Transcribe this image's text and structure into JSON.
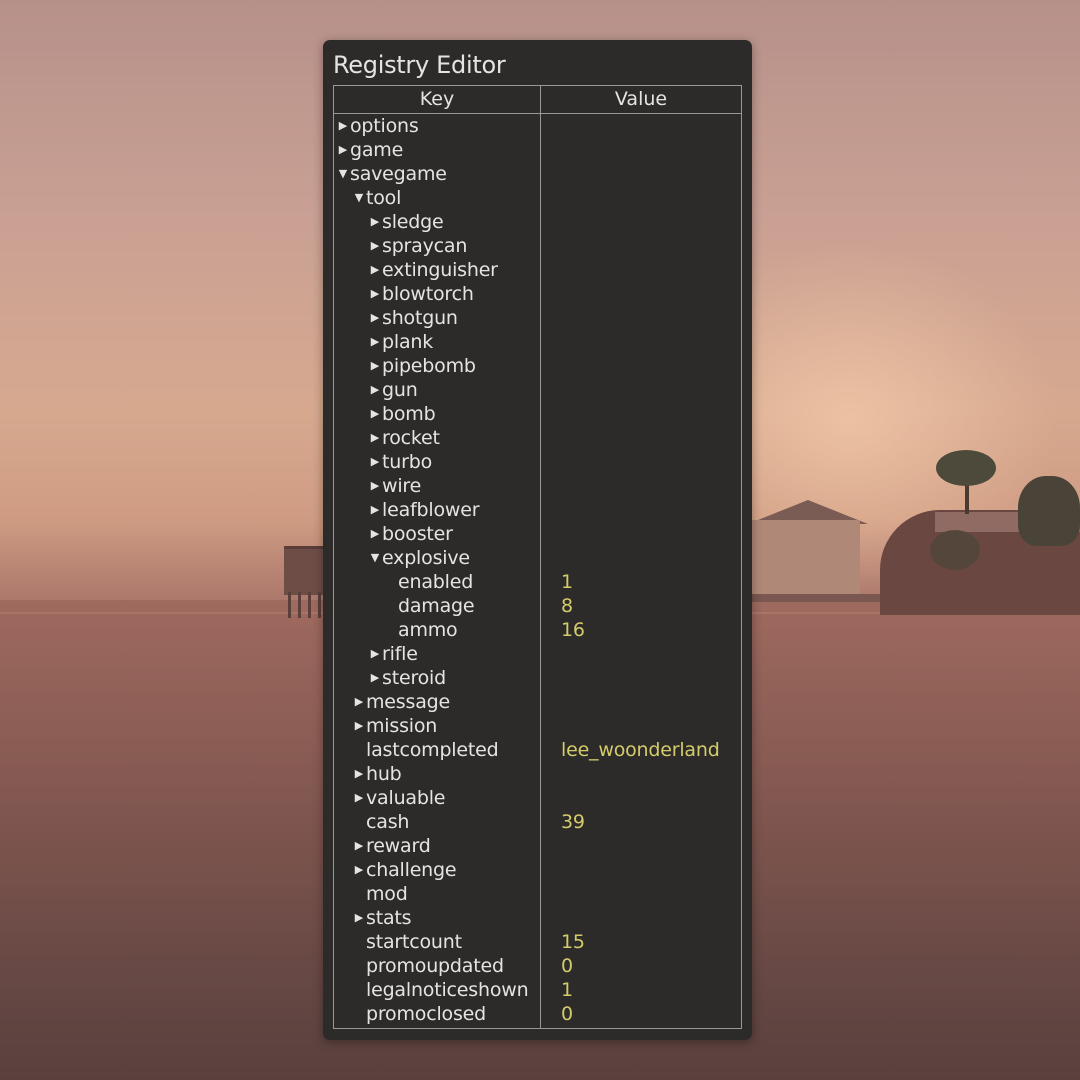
{
  "window": {
    "title": "Registry Editor"
  },
  "table": {
    "columns": [
      "Key",
      "Value"
    ],
    "rows": [
      {
        "key": "options",
        "value": "",
        "depth": 0,
        "expander": "collapsed"
      },
      {
        "key": "game",
        "value": "",
        "depth": 0,
        "expander": "collapsed"
      },
      {
        "key": "savegame",
        "value": "",
        "depth": 0,
        "expander": "expanded"
      },
      {
        "key": "tool",
        "value": "",
        "depth": 1,
        "expander": "expanded"
      },
      {
        "key": "sledge",
        "value": "",
        "depth": 2,
        "expander": "collapsed"
      },
      {
        "key": "spraycan",
        "value": "",
        "depth": 2,
        "expander": "collapsed"
      },
      {
        "key": "extinguisher",
        "value": "",
        "depth": 2,
        "expander": "collapsed"
      },
      {
        "key": "blowtorch",
        "value": "",
        "depth": 2,
        "expander": "collapsed"
      },
      {
        "key": "shotgun",
        "value": "",
        "depth": 2,
        "expander": "collapsed"
      },
      {
        "key": "plank",
        "value": "",
        "depth": 2,
        "expander": "collapsed"
      },
      {
        "key": "pipebomb",
        "value": "",
        "depth": 2,
        "expander": "collapsed"
      },
      {
        "key": "gun",
        "value": "",
        "depth": 2,
        "expander": "collapsed"
      },
      {
        "key": "bomb",
        "value": "",
        "depth": 2,
        "expander": "collapsed"
      },
      {
        "key": "rocket",
        "value": "",
        "depth": 2,
        "expander": "collapsed"
      },
      {
        "key": "turbo",
        "value": "",
        "depth": 2,
        "expander": "collapsed"
      },
      {
        "key": "wire",
        "value": "",
        "depth": 2,
        "expander": "collapsed"
      },
      {
        "key": "leafblower",
        "value": "",
        "depth": 2,
        "expander": "collapsed"
      },
      {
        "key": "booster",
        "value": "",
        "depth": 2,
        "expander": "collapsed"
      },
      {
        "key": "explosive",
        "value": "",
        "depth": 2,
        "expander": "expanded"
      },
      {
        "key": "enabled",
        "value": "1",
        "depth": 3,
        "expander": "none"
      },
      {
        "key": "damage",
        "value": "8",
        "depth": 3,
        "expander": "none"
      },
      {
        "key": "ammo",
        "value": "16",
        "depth": 3,
        "expander": "none"
      },
      {
        "key": "rifle",
        "value": "",
        "depth": 2,
        "expander": "collapsed"
      },
      {
        "key": "steroid",
        "value": "",
        "depth": 2,
        "expander": "collapsed"
      },
      {
        "key": "message",
        "value": "",
        "depth": 1,
        "expander": "collapsed"
      },
      {
        "key": "mission",
        "value": "",
        "depth": 1,
        "expander": "collapsed"
      },
      {
        "key": "lastcompleted",
        "value": "lee_woonderland",
        "depth": 1,
        "expander": "none"
      },
      {
        "key": "hub",
        "value": "",
        "depth": 1,
        "expander": "collapsed"
      },
      {
        "key": "valuable",
        "value": "",
        "depth": 1,
        "expander": "collapsed"
      },
      {
        "key": "cash",
        "value": "39",
        "depth": 1,
        "expander": "none"
      },
      {
        "key": "reward",
        "value": "",
        "depth": 1,
        "expander": "collapsed"
      },
      {
        "key": "challenge",
        "value": "",
        "depth": 1,
        "expander": "collapsed"
      },
      {
        "key": "mod",
        "value": "",
        "depth": 1,
        "expander": "none"
      },
      {
        "key": "stats",
        "value": "",
        "depth": 1,
        "expander": "collapsed"
      },
      {
        "key": "startcount",
        "value": "15",
        "depth": 1,
        "expander": "none"
      },
      {
        "key": "promoupdated",
        "value": "0",
        "depth": 1,
        "expander": "none"
      },
      {
        "key": "legalnoticeshown",
        "value": "1",
        "depth": 1,
        "expander": "none"
      },
      {
        "key": "promoclosed",
        "value": "0",
        "depth": 1,
        "expander": "none"
      }
    ]
  },
  "icons": {
    "collapsed": "caret-right-icon",
    "expanded": "caret-down-icon"
  },
  "colors": {
    "panel_bg": "#2c2b2a",
    "text": "#e6e4e1",
    "value_text": "#d4cc6a",
    "grid_line": "#9a9896"
  }
}
